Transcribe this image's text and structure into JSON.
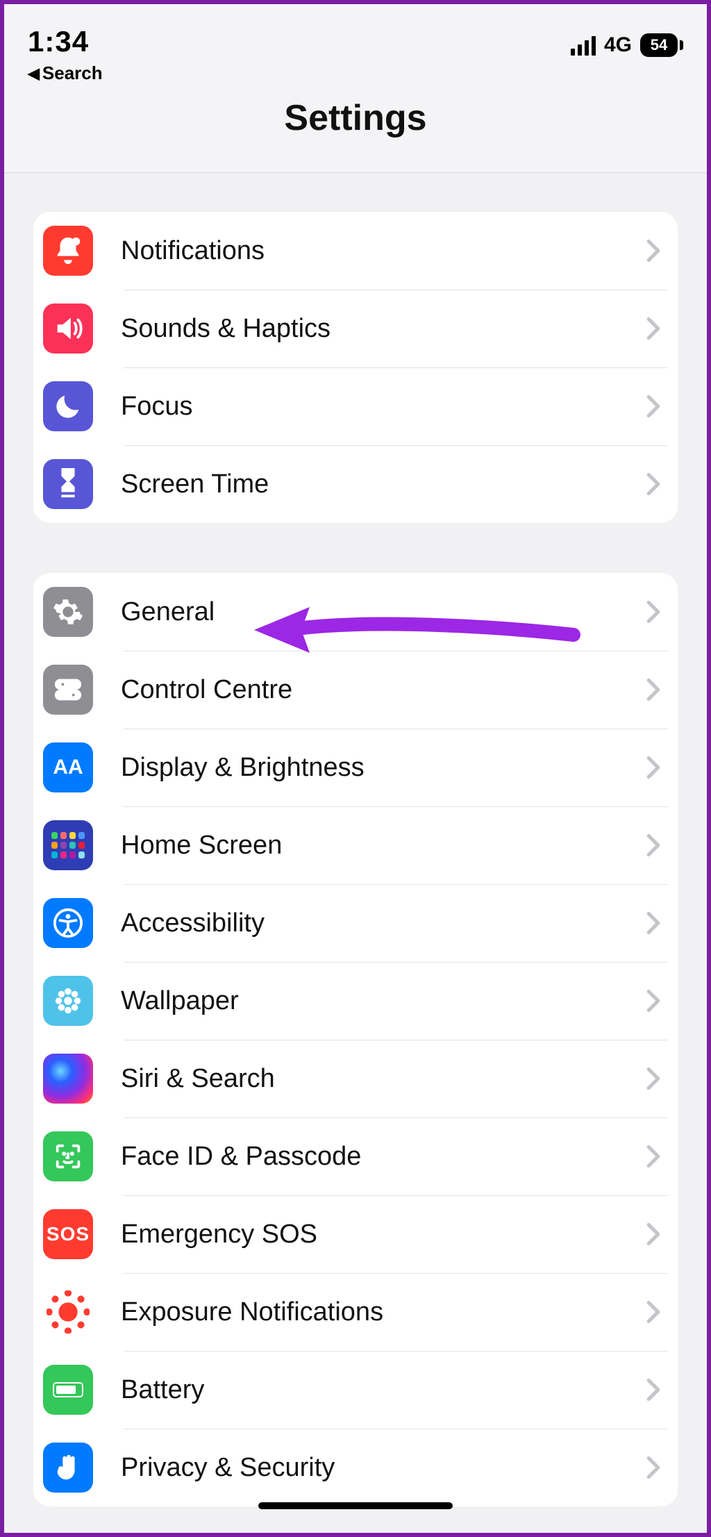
{
  "status": {
    "time": "1:34",
    "back_label": "Search",
    "network": "4G",
    "battery": "54"
  },
  "header": {
    "title": "Settings"
  },
  "groups": [
    {
      "id": "group-alerts",
      "items": [
        {
          "id": "notifications",
          "label": "Notifications",
          "icon": "bell-icon",
          "bg": "bg-red"
        },
        {
          "id": "sounds-haptics",
          "label": "Sounds & Haptics",
          "icon": "speaker-icon",
          "bg": "bg-pink"
        },
        {
          "id": "focus",
          "label": "Focus",
          "icon": "moon-icon",
          "bg": "bg-indigo"
        },
        {
          "id": "screen-time",
          "label": "Screen Time",
          "icon": "hourglass-icon",
          "bg": "bg-indigo"
        }
      ]
    },
    {
      "id": "group-general",
      "items": [
        {
          "id": "general",
          "label": "General",
          "icon": "gear-icon",
          "bg": "bg-grey"
        },
        {
          "id": "control-centre",
          "label": "Control Centre",
          "icon": "toggles-icon",
          "bg": "bg-grey"
        },
        {
          "id": "display-brightness",
          "label": "Display & Brightness",
          "icon": "aa-icon",
          "bg": "bg-blue"
        },
        {
          "id": "home-screen",
          "label": "Home Screen",
          "icon": "grid-icon",
          "bg": "bg-home"
        },
        {
          "id": "accessibility",
          "label": "Accessibility",
          "icon": "accessibility-icon",
          "bg": "bg-blue"
        },
        {
          "id": "wallpaper",
          "label": "Wallpaper",
          "icon": "flower-icon",
          "bg": "bg-cyan"
        },
        {
          "id": "siri-search",
          "label": "Siri & Search",
          "icon": "siri-icon",
          "bg": "bg-siri"
        },
        {
          "id": "face-id-passcode",
          "label": "Face ID & Passcode",
          "icon": "faceid-icon",
          "bg": "bg-green"
        },
        {
          "id": "emergency-sos",
          "label": "Emergency SOS",
          "icon": "sos-icon",
          "bg": "bg-red"
        },
        {
          "id": "exposure-notifications",
          "label": "Exposure Notifications",
          "icon": "exposure-icon",
          "bg": "bg-white"
        },
        {
          "id": "battery",
          "label": "Battery",
          "icon": "battery-icon",
          "bg": "bg-green"
        },
        {
          "id": "privacy-security",
          "label": "Privacy & Security",
          "icon": "hand-icon",
          "bg": "bg-blue2"
        }
      ]
    }
  ],
  "annotation": {
    "target": "general",
    "color": "#9C27E5"
  }
}
